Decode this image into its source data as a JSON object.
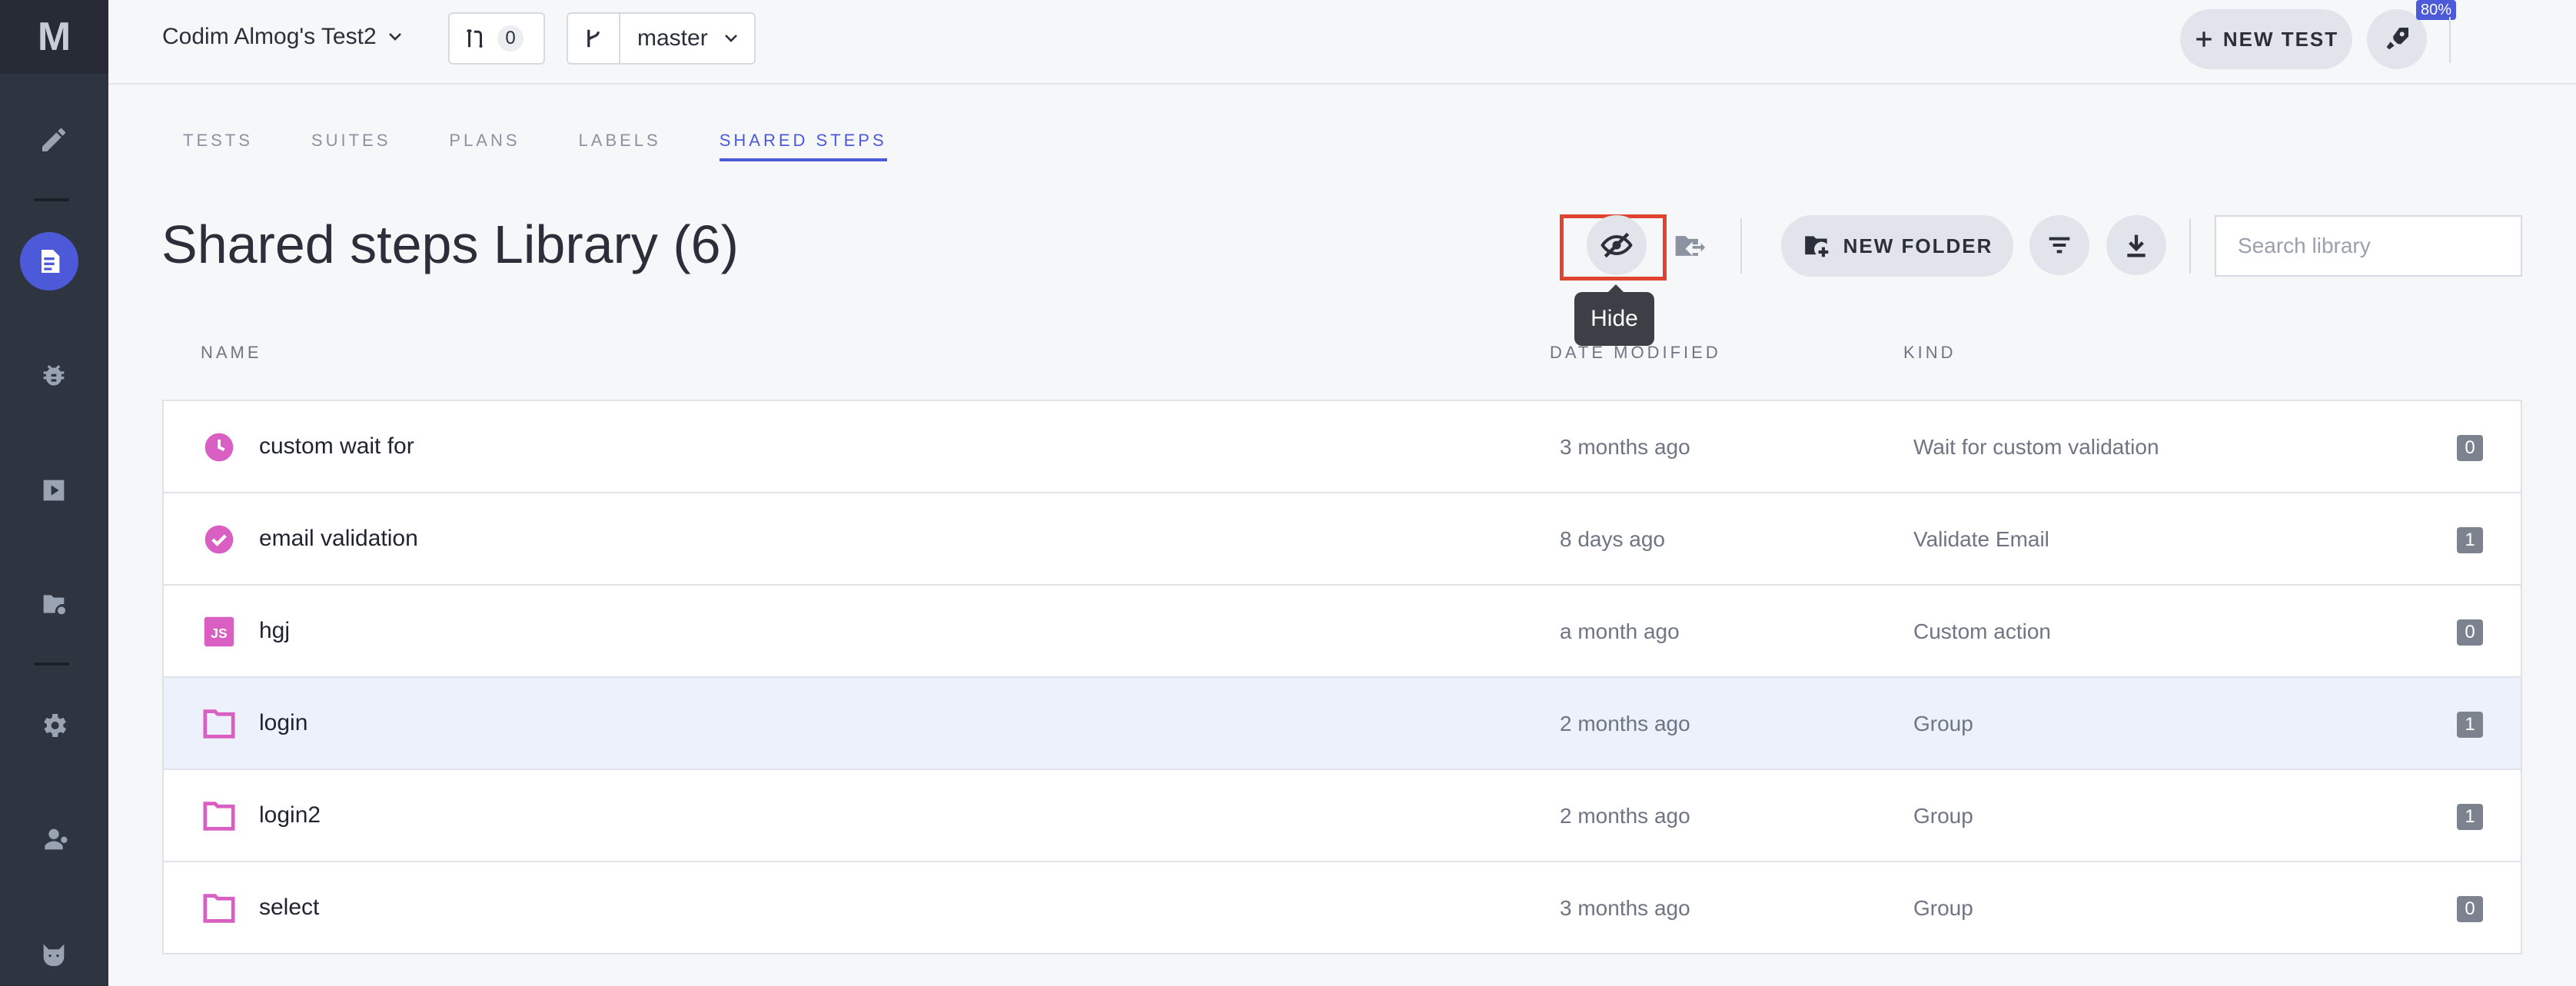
{
  "app": {
    "logo": "M",
    "accent": "#4c5ad9",
    "icon_color": "#d95fc2"
  },
  "header": {
    "project": "Codim Almog's Test2",
    "pr_count": "0",
    "branch": "master",
    "new_test_label": "NEW TEST",
    "progress_badge": "80%"
  },
  "sidebar": {
    "items": [
      {
        "name": "pencil-icon"
      },
      {
        "name": "document-icon",
        "active": true
      },
      {
        "name": "bug-icon"
      },
      {
        "name": "play-icon"
      },
      {
        "name": "folder-gear-icon"
      },
      {
        "name": "gear-icon"
      },
      {
        "name": "users-icon"
      },
      {
        "name": "cat-icon"
      }
    ]
  },
  "tabs": [
    "TESTS",
    "SUITES",
    "PLANS",
    "LABELS",
    "SHARED STEPS"
  ],
  "active_tab": "SHARED STEPS",
  "page": {
    "title": "Shared steps Library (6)"
  },
  "toolbar": {
    "hide_tooltip": "Hide",
    "new_folder_label": "NEW FOLDER",
    "search_placeholder": "Search library"
  },
  "table": {
    "columns": [
      "NAME",
      "DATE MODIFIED",
      "KIND"
    ],
    "rows": [
      {
        "icon": "clock-icon",
        "name": "custom wait for",
        "date": "3 months ago",
        "kind": "Wait for custom validation",
        "count": "0"
      },
      {
        "icon": "check-circle-icon",
        "name": "email validation",
        "date": "8 days ago",
        "kind": "Validate Email",
        "count": "1"
      },
      {
        "icon": "js-icon",
        "name": "hgj",
        "date": "a month ago",
        "kind": "Custom action",
        "count": "0"
      },
      {
        "icon": "folder-icon",
        "name": "login",
        "date": "2 months ago",
        "kind": "Group",
        "count": "1",
        "selected": true
      },
      {
        "icon": "folder-icon",
        "name": "login2",
        "date": "2 months ago",
        "kind": "Group",
        "count": "1"
      },
      {
        "icon": "folder-icon",
        "name": "select",
        "date": "3 months ago",
        "kind": "Group",
        "count": "0"
      }
    ]
  }
}
